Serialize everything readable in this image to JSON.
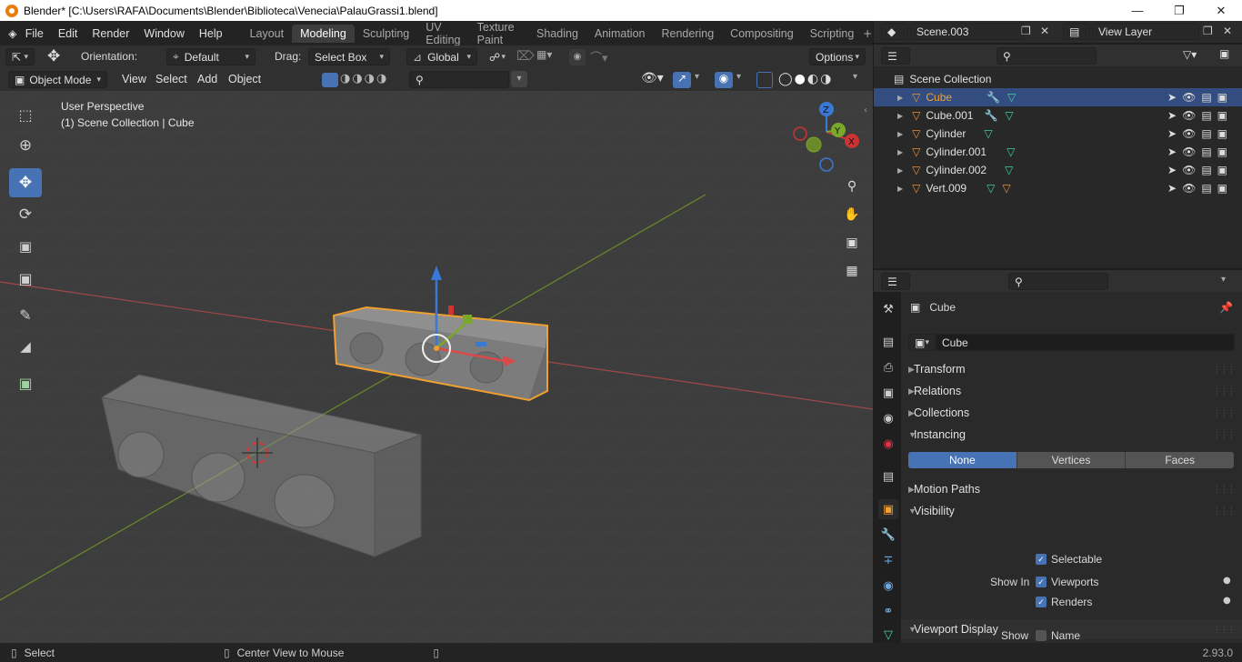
{
  "window": {
    "title": "Blender* [C:\\Users\\RAFA\\Documents\\Blender\\Biblioteca\\Venecia\\PalauGrassi1.blend]"
  },
  "menu": [
    "File",
    "Edit",
    "Render",
    "Window",
    "Help"
  ],
  "workspaces": [
    "Layout",
    "Modeling",
    "Sculpting",
    "UV Editing",
    "Texture Paint",
    "Shading",
    "Animation",
    "Rendering",
    "Compositing",
    "Scripting"
  ],
  "active_workspace": "Modeling",
  "scene": {
    "name": "Scene.003",
    "view_layer": "View Layer"
  },
  "toolbar": {
    "orientation_label": "Orientation:",
    "orientation_value": "Default",
    "drag_label": "Drag:",
    "drag_value": "Select Box",
    "transform_space": "Global",
    "options_label": "Options"
  },
  "header": {
    "mode": "Object Mode",
    "menus": [
      "View",
      "Select",
      "Add",
      "Object"
    ]
  },
  "viewport": {
    "perspective": "User Perspective",
    "collection_info": "(1) Scene Collection | Cube"
  },
  "outliner": {
    "root": "Scene Collection",
    "items": [
      {
        "name": "Cube",
        "selected": true
      },
      {
        "name": "Cube.001",
        "selected": false
      },
      {
        "name": "Cylinder",
        "selected": false
      },
      {
        "name": "Cylinder.001",
        "selected": false
      },
      {
        "name": "Cylinder.002",
        "selected": false
      },
      {
        "name": "Vert.009",
        "selected": false
      }
    ]
  },
  "properties": {
    "object_name": "Cube",
    "object_field": "Cube",
    "sections": {
      "transform": "Transform",
      "relations": "Relations",
      "collections": "Collections",
      "instancing": "Instancing",
      "motion_paths": "Motion Paths",
      "visibility": "Visibility",
      "viewport_display": "Viewport Display"
    },
    "instancing_options": [
      "None",
      "Vertices",
      "Faces"
    ],
    "instancing_selected": "None",
    "visibility": {
      "selectable": "Selectable",
      "show_in_label": "Show In",
      "viewports": "Viewports",
      "renders": "Renders"
    },
    "viewport_display": {
      "show_label": "Show",
      "name_label": "Name"
    }
  },
  "status": {
    "select": "Select",
    "center_view": "Center View to Mouse",
    "version": "2.93.0"
  },
  "colors": {
    "accent": "#4772b3",
    "selection": "#f0a030",
    "x_axis": "#cc3333",
    "y_axis": "#7aa82a",
    "z_axis": "#3a78d6",
    "mesh": "#e8913d",
    "data": "#3fd1a8"
  },
  "icons": [
    "blender-logo",
    "scene-icon",
    "view-layer-icon",
    "move-tool-icon",
    "cursor-icon",
    "rotate-icon",
    "scale-icon",
    "transform-icon",
    "annotate-icon",
    "measure-icon",
    "add-cube-icon",
    "zoom-icon",
    "hand-icon",
    "camera-icon",
    "grid-icon",
    "eye-icon",
    "pointer-icon",
    "render-icon"
  ]
}
